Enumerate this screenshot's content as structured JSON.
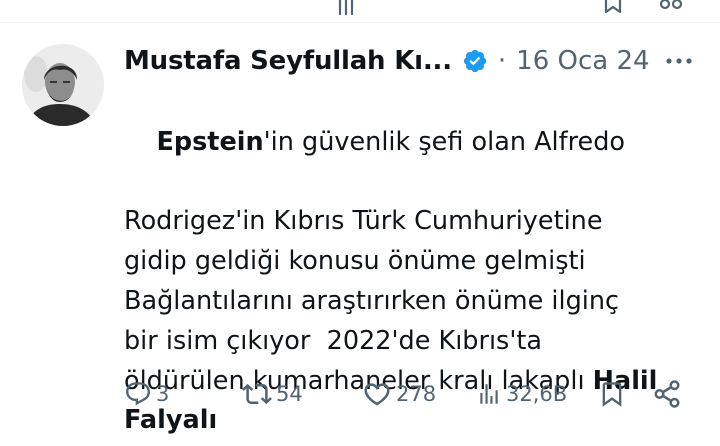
{
  "tweet": {
    "author": {
      "display_name": "Mustafa Seyfullah Kı...",
      "verified": true
    },
    "separator": "·",
    "date": "16 Oca 24",
    "text_lines": [
      [
        {
          "text": "Epstein",
          "bold": true
        },
        {
          "text": "'in güvenlik şefi olan Alfredo",
          "bold": false
        }
      ],
      [
        {
          "text": "Rodrigez'in Kıbrıs Türk Cumhuriyetine",
          "bold": false
        }
      ],
      [
        {
          "text": "gidip geldiği konusu önüme gelmişti",
          "bold": false
        }
      ],
      [
        {
          "text": "Bağlantılarını araştırırken önüme ilginç",
          "bold": false
        }
      ],
      [
        {
          "text": "bir isim çıkıyor  2022'de Kıbrıs'ta",
          "bold": false
        }
      ],
      [
        {
          "text": "öldürülen kumarhaneler kralı lakaplı ",
          "bold": false
        },
        {
          "text": "Halil",
          "bold": true
        }
      ],
      [
        {
          "text": "Falyalı",
          "bold": true
        }
      ]
    ],
    "stats": {
      "replies": "3",
      "retweets": "54",
      "likes": "278",
      "views": "32,6B"
    }
  },
  "icons": {
    "reply": "reply-icon",
    "retweet": "retweet-icon",
    "like": "heart-icon",
    "views": "views-icon",
    "bookmark": "bookmark-icon",
    "share": "share-icon",
    "more": "more-icon",
    "verified": "verified-badge-icon"
  },
  "colors": {
    "text_primary": "#0f1419",
    "text_secondary": "#536471",
    "verified_blue": "#1d9bf0",
    "divider": "#eff3f4"
  }
}
